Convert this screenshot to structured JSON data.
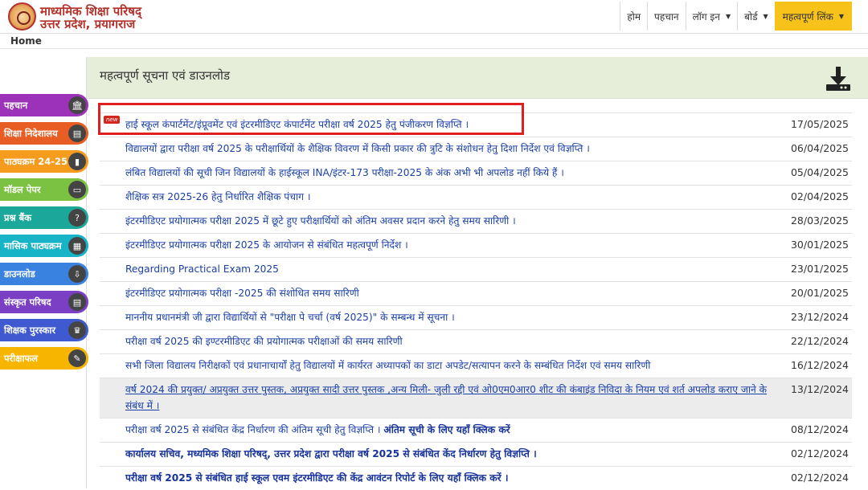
{
  "brand": {
    "line1": "माध्यमिक शिक्षा परिषद्",
    "line2": "उत्तर प्रदेश, प्रयागराज"
  },
  "nav": [
    {
      "label": "होम",
      "dropdown": false
    },
    {
      "label": "पहचान",
      "dropdown": false
    },
    {
      "label": "लॉग इन",
      "dropdown": true
    },
    {
      "label": "बोर्ड",
      "dropdown": true
    },
    {
      "label": "महत्वपूर्ण लिंक",
      "dropdown": true,
      "highlight": true
    }
  ],
  "breadcrumb": "Home",
  "panel": {
    "title": "महत्वपूर्ण सूचना एवं डाउनलोड",
    "icon": "download-icon"
  },
  "sidebar": [
    {
      "label": "पहचान",
      "color": "#9c32b8",
      "icon": "bank-icon",
      "glyph": "🏛"
    },
    {
      "label": "शिक्षा निदेशालय",
      "color": "#e85d24",
      "icon": "document-icon",
      "glyph": "▤"
    },
    {
      "label": "पाठ्यक्रम 24-25",
      "color": "#f59b1d",
      "icon": "book-icon",
      "glyph": "▮"
    },
    {
      "label": "मॉडल पेपर",
      "color": "#7cc242",
      "icon": "paper-icon",
      "glyph": "▭"
    },
    {
      "label": "प्रश्न बैंक",
      "color": "#1ba89a",
      "icon": "question-icon",
      "glyph": "?"
    },
    {
      "label": "मासिक पाठ्यक्रम",
      "color": "#17b3c7",
      "icon": "calendar-icon",
      "glyph": "▦"
    },
    {
      "label": "डाउनलोड",
      "color": "#3a82e0",
      "icon": "download-icon",
      "glyph": "⇩"
    },
    {
      "label": "संस्कृत परिषद",
      "color": "#7a3fc4",
      "icon": "document-icon",
      "glyph": "▤"
    },
    {
      "label": "शिक्षक पुरस्कार",
      "color": "#3f5ad0",
      "icon": "trophy-icon",
      "glyph": "♛"
    },
    {
      "label": "परीक्षाफल",
      "color": "#f7b500",
      "icon": "graduation-cap-icon",
      "glyph": "✎"
    }
  ],
  "notices": [
    {
      "text": "हाई स्कूल कंपार्टमेंट/इंप्रूवमेंट एवं इंटरमीडिएट कंपार्टमेंट परीक्षा वर्ष 2025 हेतु पंजीकरण विज्ञप्ति ।",
      "date": "17/05/2025",
      "badge": "new",
      "highlighted": true
    },
    {
      "text": "विद्यालयों द्वारा परीक्षा वर्ष 2025 के परीक्षार्थियों के शैक्षिक विवरण में किसी प्रकार की त्रुटि के संशोधन हेतु दिशा निर्देश एवं विज्ञप्ति ।",
      "date": "06/04/2025"
    },
    {
      "text": "लंबित विद्यालयों की सूची जिन विद्यालयों के हाईस्कूल INA/इंटर-173 परीक्षा-2025 के अंक अभी भी अपलोड नहीं किये हैं ।",
      "date": "05/04/2025"
    },
    {
      "text": "शैक्षिक सत्र 2025-26 हेतु निर्धारित शैक्षिक पंचाग ।",
      "date": "02/04/2025"
    },
    {
      "text": "इंटरमीडिएट प्रयोगात्मक परीक्षा 2025 में छूटे हुए परीक्षार्थियों को अंतिम अवसर प्रदान करने हेतु समय सारिणी ।",
      "date": "28/03/2025"
    },
    {
      "text": "इंटरमीडिएट प्रयोगात्मक परीक्षा 2025 के आयोजन से संबंधित महत्वपूर्ण निर्देश ।",
      "date": "30/01/2025"
    },
    {
      "text": "Regarding Practical Exam 2025",
      "date": "23/01/2025"
    },
    {
      "text": "इंटरमीडिएट प्रयोगात्मक परीक्षा -2025 की संशोधित समय सारिणी",
      "date": "20/01/2025"
    },
    {
      "text": "माननीय प्रधानमंत्री जी द्वारा विद्यार्थियों से \"परीक्षा पे चर्चा (वर्ष 2025)\" के सम्बन्ध में सूचना ।",
      "date": "23/12/2024"
    },
    {
      "text": "परीक्षा वर्ष 2025 की इण्टरमीडिएट की प्रयोगात्मक परीक्षाओं की समय सारिणी",
      "date": "22/12/2024"
    },
    {
      "text": "सभी जिला विद्यालय निरीक्षकों एवं प्रधानाचार्यों हेतु विद्यालयों में कार्यरत अध्यापकों का डाटा अपडेट/सत्यापन करने के सम्बंधित निर्देश एवं समय सारिणी",
      "date": "16/12/2024"
    },
    {
      "text": "वर्ष 2024 की प्रयुक्त/ अप्रयुक्त उत्तर पुस्तक, अप्रयुक्त सादी उत्तर पुस्तक ,अन्य मिली- जुली रद्दी एवं ओ0एम0आर0 शीट की कंबाइंड निविदा के नियम एवं शर्त अपलोड कराए जाने के संबंध में ।",
      "date": "13/12/2024",
      "shaded": true
    },
    {
      "text": "परीक्षा वर्ष 2025 से संबंधित केंद्र निर्धारण की अंतिम सूची हेतु विज्ञप्ति ।",
      "text_bold": "अंतिम सूची के लिए यहाँ क्लिक करें",
      "date": "08/12/2024"
    },
    {
      "text": "कार्यालय सचिव, मध्यमिक शिक्षा परिषद्, उत्तर प्रदेश द्वारा परीक्षा वर्ष 2025 से संबंधित केंद निर्धारण हेतु विज्ञप्ति ।",
      "date": "02/12/2024",
      "bold": true
    },
    {
      "text": "परीक्षा वर्ष 2025 से संबंधित हाई स्कूल एवम इंटरमीडिएट की केंद्र आवंटन रिपोर्ट के लिए यहाँ क्लिक करें ।",
      "date": "02/12/2024",
      "bold": true
    }
  ]
}
